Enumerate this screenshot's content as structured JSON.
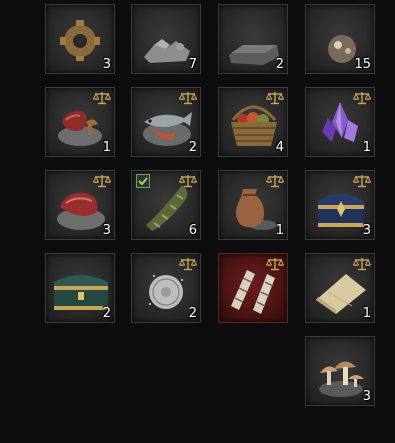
{
  "inventory": {
    "row1": [
      {
        "name": "gear-item",
        "qty": "3"
      },
      {
        "name": "rubble-item",
        "qty": "7"
      },
      {
        "name": "ingot-item",
        "qty": "2"
      },
      {
        "name": "ore-item",
        "qty": "15"
      }
    ],
    "row2": [
      {
        "name": "meat-mushroom-item",
        "qty": "1",
        "tradeable": true
      },
      {
        "name": "fish-item",
        "qty": "2",
        "tradeable": true
      },
      {
        "name": "food-basket-item",
        "qty": "4",
        "tradeable": true
      },
      {
        "name": "purple-crystal-item",
        "qty": "1",
        "tradeable": true
      }
    ],
    "row3": [
      {
        "name": "raw-meat-item",
        "qty": "3",
        "tradeable": true
      },
      {
        "name": "wrapped-bundle-item",
        "qty": "6",
        "tradeable": true,
        "checked": true
      },
      {
        "name": "sack-item",
        "qty": "1",
        "tradeable": true
      },
      {
        "name": "blue-chest-item",
        "qty": "3",
        "tradeable": true
      }
    ],
    "row4": [
      {
        "name": "green-chest-item",
        "qty": "2"
      },
      {
        "name": "silver-coin-item",
        "qty": "2",
        "tradeable": true
      },
      {
        "name": "bandage-wraps-item",
        "qty": "",
        "tradeable": true,
        "rarity": "red"
      },
      {
        "name": "cloth-roll-item",
        "qty": "1",
        "tradeable": true
      }
    ],
    "row5": [
      {
        "name": "mushrooms-item",
        "qty": "3"
      }
    ]
  },
  "colors": {
    "background": "#0d0d0d",
    "slot": "#2a2a2a",
    "slot_border": "#3a3a3a",
    "rare_slot": "#4a1414",
    "scale_icon": "#c9a55a",
    "quantity_text": "#ffffff"
  }
}
